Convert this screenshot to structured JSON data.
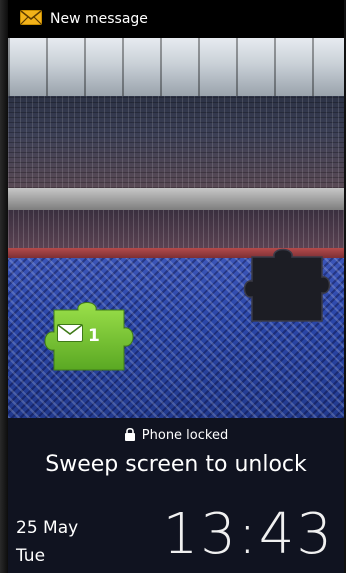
{
  "status_bar": {
    "notification_text": "New message"
  },
  "widget": {
    "unread_count": "1"
  },
  "lock": {
    "status": "Phone locked",
    "instruction": "Sweep screen to unlock"
  },
  "clock": {
    "date": "25 May",
    "day": "Tue",
    "time": "13:43"
  },
  "colors": {
    "accent_green": "#7ec93a",
    "status_icon": "#f2b21a"
  }
}
